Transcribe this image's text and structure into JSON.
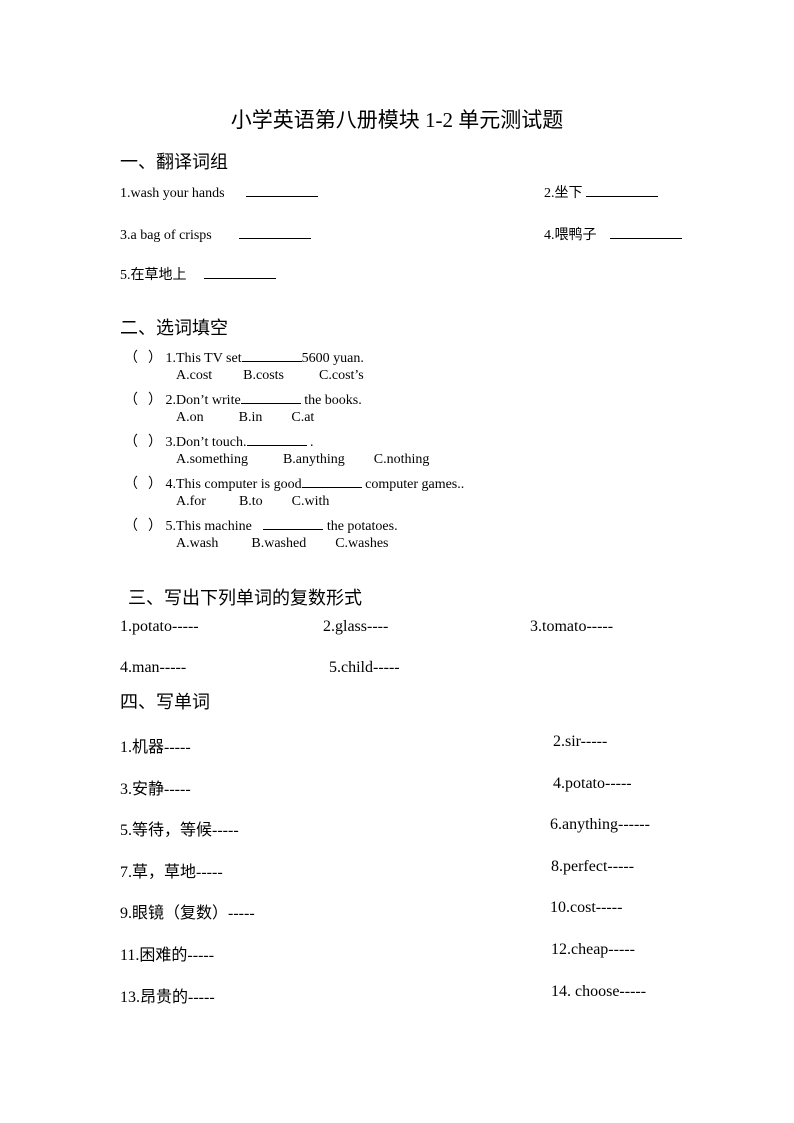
{
  "title": "小学英语第八册模块 1-2 单元测试题",
  "section1": {
    "heading": "一、翻译词组",
    "items": [
      {
        "text": "1.wash your hands"
      },
      {
        "text": "2.坐下"
      },
      {
        "text": "3.a bag of crisps"
      },
      {
        "text": "4.喂鸭子"
      },
      {
        "text": "5.在草地上"
      }
    ]
  },
  "section2": {
    "heading": "二、选词填空",
    "paren_open": "（",
    "paren_close": "）",
    "questions": [
      {
        "before": "1.This TV set",
        "after": "5600 yuan.",
        "options": [
          "A.cost",
          "B.costs",
          "C.cost’s"
        ]
      },
      {
        "before": "2.Don’t write",
        "after": " the books.",
        "options": [
          "A.on",
          "B.in",
          "C.at"
        ]
      },
      {
        "before": "3.Don’t touch.",
        "after": " .",
        "options": [
          "A.something",
          "B.anything",
          "C.nothing"
        ]
      },
      {
        "before": "4.This computer is good",
        "after": " computer games..",
        "options": [
          "A.for",
          "B.to",
          "C.with"
        ]
      },
      {
        "before": "5.This machine ",
        "after": "  the potatoes.",
        "options": [
          "A.wash",
          "B.washed",
          "C.washes"
        ]
      }
    ]
  },
  "section3": {
    "heading": "三、写出下列单词的复数形式",
    "items": [
      "1.potato-----",
      "2.glass----",
      "3.tomato-----",
      "4.man-----",
      "5.child-----"
    ]
  },
  "section4": {
    "heading": "四、写单词",
    "items": [
      "1.机器-----",
      "2.sir-----",
      "3.安静-----",
      "4.potato-----",
      "5.等待，等候-----",
      "6.anything------",
      "7.草，草地-----",
      "8.perfect-----",
      "9.眼镜（复数）-----",
      "10.cost-----",
      "11.困难的-----",
      "12.cheap-----",
      "13.昂贵的-----",
      "14. choose-----"
    ]
  }
}
